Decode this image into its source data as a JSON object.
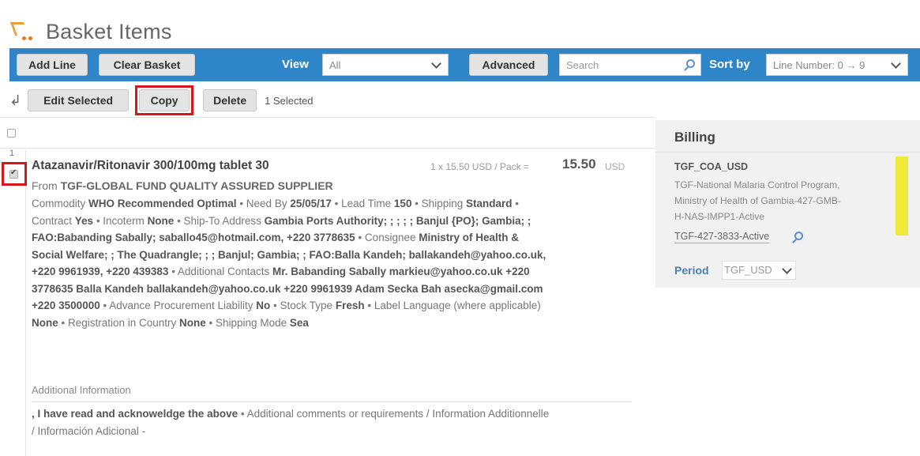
{
  "header": {
    "title": "Basket Items"
  },
  "toolbar": {
    "add_line": "Add Line",
    "clear_basket": "Clear Basket",
    "view_label": "View",
    "view_value": "All",
    "advanced": "Advanced",
    "search_placeholder": "Search",
    "sort_label": "Sort by",
    "sort_value": "Line Number: 0 → 9"
  },
  "actions": {
    "edit_selected": "Edit Selected",
    "copy": "Copy",
    "delete": "Delete",
    "selected_count": "1 Selected"
  },
  "item": {
    "line_number": "1",
    "name": "Atazanavir/Ritonavir 300/100mg tablet 30",
    "qty_price": "1 x 15.50 USD / Pack =",
    "total": "15.50",
    "currency": "USD",
    "from_label": "From",
    "supplier": "TGF-GLOBAL FUND QUALITY ASSURED SUPPLIER",
    "l1": [
      "Commodity",
      "WHO Recommended Optimal",
      " • Need By ",
      "25/05/17",
      " • Lead Time ",
      "150",
      " • Shipping ",
      "Standard",
      " •"
    ],
    "l2": [
      "Contract ",
      "Yes",
      " • Incoterm ",
      "None",
      " • Ship-To Address ",
      "Gambia Ports Authority; ; ; ; ; Banjul {PO}; Gambia; ;"
    ],
    "l3": [
      "FAO:Babanding Sabally; saballo45@hotmail.com, +220 3778635",
      " • Consignee ",
      "Ministry of Health &"
    ],
    "l4": [
      "Social Welfare; ; The Quadrangle; ; ; Banjul; Gambia; ; FAO:Balla Kandeh; ballakandeh@yahoo.co.uk,"
    ],
    "l5": [
      "+220 9961939, +220 439383",
      " • Additional Contacts ",
      "Mr. Babanding Sabally markieu@yahoo.co.uk +220"
    ],
    "l6": [
      "3778635 Balla Kandeh ballakandeh@yahoo.co.uk +220 9961939 Adam Secka Bah asecka@gmail.com"
    ],
    "l7": [
      "+220 3500000",
      " • Advance Procurement Liability ",
      "No",
      " • Stock Type ",
      "Fresh",
      " • Label Language (where applicable)"
    ],
    "l8": [
      "None",
      " • Registration in Country ",
      "None",
      " • Shipping Mode ",
      "Sea"
    ],
    "additional_info_label": "Additional Information",
    "ack_bold": ", I have read and acknoweldge the above",
    "ack_rest": " • Additional comments or requirements / Information Additionnelle",
    "ack_line2": "/ Información Adicional -"
  },
  "billing": {
    "title": "Billing",
    "coa": "TGF_COA_USD",
    "desc1": "TGF-National Malaria Control Program,",
    "desc2": "Ministry of Health of Gambia-427-GMB-",
    "desc3": "H-NAS-IMPP1-Active",
    "account": "TGF-427-3833-Active",
    "period_label": "Period",
    "period_value": "TGF_USD"
  },
  "colors": {
    "toolbar_blue": "#2e85c7",
    "highlight_red": "#d9141b",
    "yellow_marker": "#f0ea3a"
  }
}
